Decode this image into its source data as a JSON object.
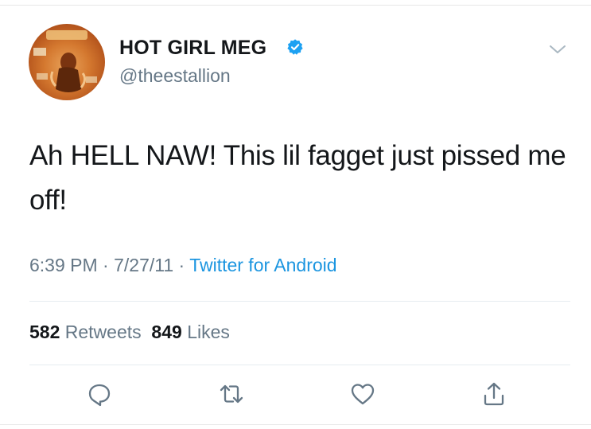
{
  "user": {
    "display_name": "HOT GIRL MEG",
    "handle": "@theestallion",
    "verified": true
  },
  "tweet": {
    "text": "Ah HELL NAW! This lil fagget just pissed me off!",
    "time": "6:39 PM",
    "separator": "·",
    "date": "7/27/11",
    "source": "Twitter for Android"
  },
  "stats": {
    "retweets_count": "582",
    "retweets_label": "Retweets",
    "likes_count": "849",
    "likes_label": "Likes"
  },
  "icons": {
    "verified": "verified-badge-icon",
    "menu": "chevron-down-icon",
    "reply": "reply-icon",
    "retweet": "retweet-icon",
    "like": "heart-icon",
    "share": "share-icon"
  },
  "colors": {
    "text": "#14171a",
    "secondary": "#657786",
    "link": "#1b95e0",
    "divider": "#e6ecf0"
  }
}
